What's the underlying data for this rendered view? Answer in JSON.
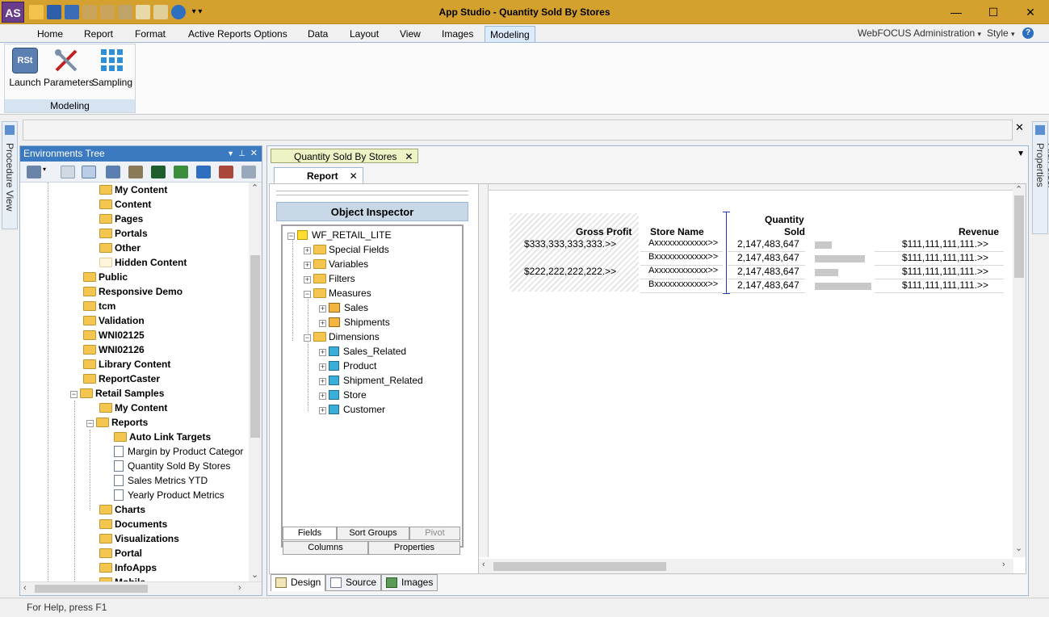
{
  "window": {
    "title": "App Studio - Quantity Sold By Stores",
    "logo": "AS",
    "controls": {
      "minimize": "—",
      "maximize": "☐",
      "close": "✕"
    }
  },
  "ribbon": {
    "tabs": [
      "Home",
      "Report",
      "Format",
      "Active Reports Options",
      "Data",
      "Layout",
      "View",
      "Images",
      "Modeling"
    ],
    "active_tab": "Modeling",
    "right": {
      "admin": "WebFOCUS Administration",
      "style": "Style",
      "help": "?"
    },
    "group": {
      "label": "Modeling",
      "buttons": [
        {
          "label": "Launch",
          "icon": "rst-launch-icon"
        },
        {
          "label": "Parameters",
          "icon": "tools-icon"
        },
        {
          "label": "Sampling",
          "icon": "grid-icon"
        }
      ]
    }
  },
  "side_tabs": {
    "left": "Procedure View",
    "right": "File/Folder Properties"
  },
  "env_tree": {
    "title": "Environments Tree",
    "items": [
      {
        "label": "My Content",
        "level": 2,
        "icon": "folder"
      },
      {
        "label": "Content",
        "level": 2,
        "icon": "folder"
      },
      {
        "label": "Pages",
        "level": 2,
        "icon": "folder"
      },
      {
        "label": "Portals",
        "level": 2,
        "icon": "folder"
      },
      {
        "label": "Other",
        "level": 2,
        "icon": "folder"
      },
      {
        "label": "Hidden Content",
        "level": 2,
        "icon": "folder-light"
      },
      {
        "label": "Public",
        "level": 1,
        "icon": "folder"
      },
      {
        "label": "Responsive Demo",
        "level": 1,
        "icon": "folder"
      },
      {
        "label": "tcm",
        "level": 1,
        "icon": "folder"
      },
      {
        "label": "Validation",
        "level": 1,
        "icon": "folder"
      },
      {
        "label": "WNI02125",
        "level": 1,
        "icon": "folder"
      },
      {
        "label": "WNI02126",
        "level": 1,
        "icon": "folder"
      },
      {
        "label": "Library Content",
        "level": 1,
        "icon": "folder"
      },
      {
        "label": "ReportCaster",
        "level": 1,
        "icon": "folder"
      },
      {
        "label": "Retail Samples",
        "level": 1,
        "icon": "folder",
        "expander": "−"
      },
      {
        "label": "My Content",
        "level": 2,
        "icon": "folder"
      },
      {
        "label": "Reports",
        "level": 2,
        "icon": "folder",
        "expander": "−"
      },
      {
        "label": "Auto Link Targets",
        "level": 3,
        "icon": "folder"
      },
      {
        "label": "Margin by Product Categor",
        "level": 3,
        "icon": "doc"
      },
      {
        "label": "Quantity Sold By Stores",
        "level": 3,
        "icon": "doc"
      },
      {
        "label": "Sales Metrics YTD",
        "level": 3,
        "icon": "doc"
      },
      {
        "label": "Yearly Product Metrics",
        "level": 3,
        "icon": "doc"
      },
      {
        "label": "Charts",
        "level": 2,
        "icon": "folder"
      },
      {
        "label": "Documents",
        "level": 2,
        "icon": "folder"
      },
      {
        "label": "Visualizations",
        "level": 2,
        "icon": "folder"
      },
      {
        "label": "Portal",
        "level": 2,
        "icon": "folder"
      },
      {
        "label": "InfoApps",
        "level": 2,
        "icon": "folder"
      },
      {
        "label": "Mobile",
        "level": 2,
        "icon": "folder"
      }
    ]
  },
  "document": {
    "tab": "Quantity Sold By Stores",
    "subtab": "Report",
    "close": "✕"
  },
  "object_inspector": {
    "title": "Object Inspector",
    "root": "WF_RETAIL_LITE",
    "nodes": [
      {
        "label": "Special Fields",
        "level": 1,
        "icon": "folder",
        "expander": "+"
      },
      {
        "label": "Variables",
        "level": 1,
        "icon": "folder",
        "expander": "+"
      },
      {
        "label": "Filters",
        "level": 1,
        "icon": "folder",
        "expander": "+"
      },
      {
        "label": "Measures",
        "level": 1,
        "icon": "folder",
        "expander": "−"
      },
      {
        "label": "Sales",
        "level": 2,
        "icon": "measure",
        "expander": "+"
      },
      {
        "label": "Shipments",
        "level": 2,
        "icon": "measure",
        "expander": "+"
      },
      {
        "label": "Dimensions",
        "level": 1,
        "icon": "folder",
        "expander": "−"
      },
      {
        "label": "Sales_Related",
        "level": 2,
        "icon": "cube",
        "expander": "+"
      },
      {
        "label": "Product",
        "level": 2,
        "icon": "cube",
        "expander": "+"
      },
      {
        "label": "Shipment_Related",
        "level": 2,
        "icon": "cube",
        "expander": "+"
      },
      {
        "label": "Store",
        "level": 2,
        "icon": "cube",
        "expander": "+"
      },
      {
        "label": "Customer",
        "level": 2,
        "icon": "cube",
        "expander": "+"
      }
    ],
    "tabs_row1": [
      "Fields",
      "Sort Groups",
      "Pivot"
    ],
    "tabs_row2": [
      "Columns",
      "Properties"
    ]
  },
  "report": {
    "headers": {
      "gross_profit": "Gross Profit",
      "store_name": "Store Name",
      "quantity_line1": "Quantity",
      "quantity_line2": "Sold",
      "revenue": "Revenue"
    },
    "rows": [
      {
        "gross_profit": "$333,333,333,333.>>",
        "store": "Axxxxxxxxxxxx>>",
        "qty": "2,147,483,647",
        "bar": 0.3,
        "revenue": "$111,111,111,111.>>"
      },
      {
        "gross_profit": "",
        "store": "Bxxxxxxxxxxxx>>",
        "qty": "2,147,483,647",
        "bar": 0.88,
        "revenue": "$111,111,111,111.>>"
      },
      {
        "gross_profit": "$222,222,222,222.>>",
        "store": "Axxxxxxxxxxxx>>",
        "qty": "2,147,483,647",
        "bar": 0.42,
        "revenue": "$111,111,111,111.>>"
      },
      {
        "gross_profit": "",
        "store": "Bxxxxxxxxxxxx>>",
        "qty": "2,147,483,647",
        "bar": 1.0,
        "revenue": "$111,111,111,111.>>"
      }
    ]
  },
  "bottom_tabs": [
    "Design",
    "Source",
    "Images"
  ],
  "status": "For Help, press F1",
  "colors": {
    "title_bar": "#d4a12e",
    "panel_header": "#3b79c1",
    "doc_tab": "#eef3c6"
  }
}
